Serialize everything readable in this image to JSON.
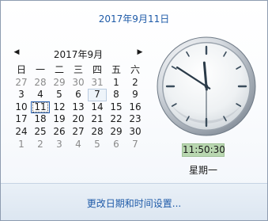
{
  "header": {
    "date_link": "2017年9月11日"
  },
  "calendar": {
    "month_title": "2017年9月",
    "prev_arrow": "◀",
    "next_arrow": "▶",
    "weekdays": [
      "日",
      "一",
      "二",
      "三",
      "四",
      "五",
      "六"
    ],
    "weeks": [
      [
        {
          "d": "27",
          "other": true
        },
        {
          "d": "28",
          "other": true
        },
        {
          "d": "29",
          "other": true
        },
        {
          "d": "30",
          "other": true
        },
        {
          "d": "31",
          "other": true
        },
        {
          "d": "1"
        },
        {
          "d": "2"
        }
      ],
      [
        {
          "d": "3"
        },
        {
          "d": "4"
        },
        {
          "d": "5"
        },
        {
          "d": "6"
        },
        {
          "d": "7",
          "highlight": true
        },
        {
          "d": "8"
        },
        {
          "d": "9"
        }
      ],
      [
        {
          "d": "10"
        },
        {
          "d": "11",
          "today": true
        },
        {
          "d": "12"
        },
        {
          "d": "13"
        },
        {
          "d": "14"
        },
        {
          "d": "15"
        },
        {
          "d": "16"
        }
      ],
      [
        {
          "d": "17"
        },
        {
          "d": "18"
        },
        {
          "d": "19"
        },
        {
          "d": "20"
        },
        {
          "d": "21"
        },
        {
          "d": "22"
        },
        {
          "d": "23"
        }
      ],
      [
        {
          "d": "24"
        },
        {
          "d": "25"
        },
        {
          "d": "26"
        },
        {
          "d": "27"
        },
        {
          "d": "28"
        },
        {
          "d": "29"
        },
        {
          "d": "30"
        }
      ],
      [
        {
          "d": "1",
          "other": true
        },
        {
          "d": "2",
          "other": true
        },
        {
          "d": "3",
          "other": true
        },
        {
          "d": "4",
          "other": true
        },
        {
          "d": "5",
          "other": true
        },
        {
          "d": "6",
          "other": true
        },
        {
          "d": "7",
          "other": true
        }
      ]
    ]
  },
  "clock": {
    "hour": 11,
    "minute": 50,
    "second": 30,
    "digital_time": "11:50:30",
    "weekday": "星期一"
  },
  "footer": {
    "settings_link": "更改日期和时间设置..."
  },
  "colors": {
    "link": "#1e5aa8",
    "today_border": "#2b62b0",
    "time_bg": "#b9d7b0"
  }
}
